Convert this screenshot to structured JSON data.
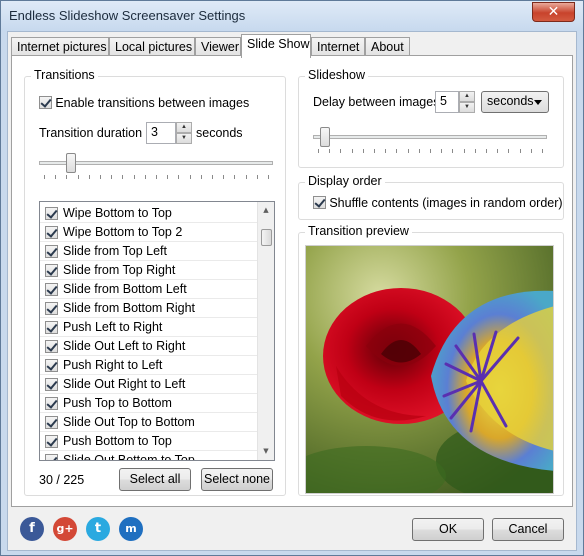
{
  "window": {
    "title": "Endless Slideshow Screensaver Settings",
    "close_label": "✕"
  },
  "tabs": [
    {
      "label": "Internet pictures"
    },
    {
      "label": "Local pictures"
    },
    {
      "label": "Viewer"
    },
    {
      "label": "Slide Show"
    },
    {
      "label": "Internet"
    },
    {
      "label": "About"
    }
  ],
  "transitions": {
    "group_label": "Transitions",
    "enable_label": "Enable transitions between images",
    "enable_checked": true,
    "duration_label": "Transition duration",
    "duration_value": "3",
    "duration_unit": "seconds",
    "duration_slider_fraction": 0.12,
    "items": [
      {
        "label": "Wipe Bottom to Top",
        "checked": true
      },
      {
        "label": "Wipe Bottom to Top 2",
        "checked": true
      },
      {
        "label": "Slide from Top Left",
        "checked": true
      },
      {
        "label": "Slide from Top Right",
        "checked": true
      },
      {
        "label": "Slide from Bottom Left",
        "checked": true
      },
      {
        "label": "Slide from Bottom Right",
        "checked": true
      },
      {
        "label": "Push Left to Right",
        "checked": true
      },
      {
        "label": "Slide Out Left to Right",
        "checked": true
      },
      {
        "label": "Push Right to Left",
        "checked": true
      },
      {
        "label": "Slide Out Right to Left",
        "checked": true
      },
      {
        "label": "Push Top to Bottom",
        "checked": true
      },
      {
        "label": "Slide Out Top to Bottom",
        "checked": true
      },
      {
        "label": "Push Bottom to Top",
        "checked": true
      },
      {
        "label": "Slide Out Bottom to Top",
        "checked": true
      }
    ],
    "count_text": "30 / 225",
    "select_all_label": "Select all",
    "select_none_label": "Select none"
  },
  "slideshow": {
    "group_label": "Slideshow",
    "delay_label": "Delay between images",
    "delay_value": "5",
    "delay_unit": "seconds",
    "delay_slider_fraction": 0.03
  },
  "display_order": {
    "group_label": "Display order",
    "shuffle_label": "Shuffle contents (images in random order)",
    "shuffle_checked": true
  },
  "preview": {
    "group_label": "Transition preview"
  },
  "social_icons": [
    "facebook-icon",
    "google-plus-icon",
    "twitter-icon",
    "myspace-icon"
  ],
  "footer": {
    "ok_label": "OK",
    "cancel_label": "Cancel"
  },
  "colors": {
    "facebook": "#3b5998",
    "google_plus": "#d34836",
    "twitter": "#2aa9e0",
    "myspace": "#1f6fc0"
  }
}
